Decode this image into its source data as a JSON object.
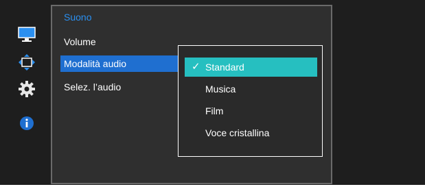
{
  "menu": {
    "title": "Suono",
    "items": [
      {
        "label": "Volume"
      },
      {
        "label": "Modalità audio"
      },
      {
        "label": "Selez. l’audio"
      }
    ]
  },
  "submenu": {
    "options": [
      {
        "label": "Standard",
        "selected": true
      },
      {
        "label": "Musica"
      },
      {
        "label": "Film"
      },
      {
        "label": "Voce cristallina"
      }
    ]
  },
  "rail_icons": [
    "monitor-icon",
    "move-arrows-icon",
    "gear-icon",
    "info-icon"
  ],
  "colors": {
    "title": "#2a8ff0",
    "selected_item": "#1f6fd0",
    "selected_option": "#26bfc0"
  }
}
